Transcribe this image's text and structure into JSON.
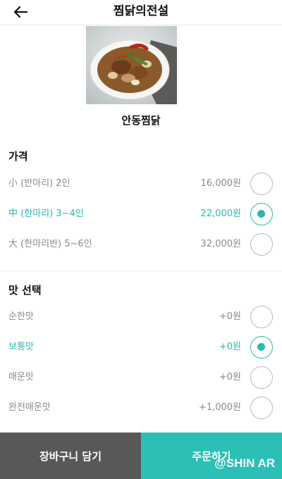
{
  "header": {
    "title": "찜닭의전설",
    "back_icon": "arrow-left-icon"
  },
  "product": {
    "name": "안동찜닭",
    "image": "braised-chicken-dish"
  },
  "price_section": {
    "title": "가격",
    "options": [
      {
        "label": "小 (반마리) 2인",
        "price": "16,000원",
        "selected": false
      },
      {
        "label": "中 (한마리) 3~4인",
        "price": "22,000원",
        "selected": true
      },
      {
        "label": "大 (한마리반) 5~6인",
        "price": "32,000원",
        "selected": false
      }
    ]
  },
  "taste_section": {
    "title": "맛 선택",
    "options": [
      {
        "label": "순한맛",
        "price": "+0원",
        "selected": false
      },
      {
        "label": "보통맛",
        "price": "+0원",
        "selected": true
      },
      {
        "label": "매운맛",
        "price": "+0원",
        "selected": false
      },
      {
        "label": "완전매운맛",
        "price": "+1,000원",
        "selected": false
      }
    ]
  },
  "actions": {
    "cart_label": "장바구니 담기",
    "order_label": "주문하기"
  },
  "watermark": "@SHIN AR",
  "colors": {
    "accent": "#2bbfb5",
    "cart_bg": "#585858",
    "muted_text": "#8a8a8a"
  }
}
